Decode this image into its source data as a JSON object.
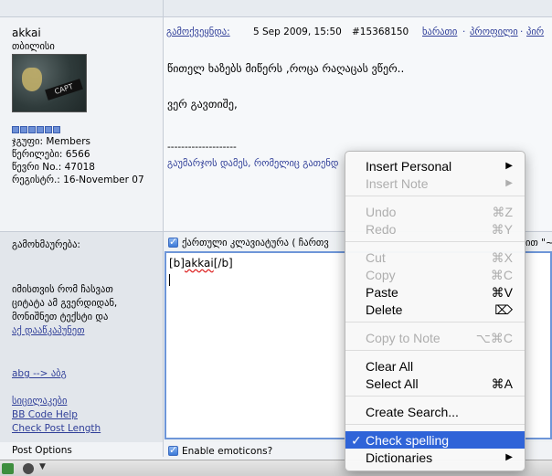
{
  "post": {
    "author": "akkai",
    "city": "თბილისი",
    "avatar_text": "CAPT",
    "group_label": "ჯგუფი: Members",
    "posts_label": "წერილები: 6566",
    "user_no_label": "წევრი No.: 47018",
    "reg_label": "რეგისტრ.: 16-November 07",
    "published_link": "გამოქვეყნდა:",
    "date": "5 Sep 2009, 15:50",
    "post_number": "#15368150",
    "actions": [
      "ხარათი",
      "პროფილი",
      "პირ"
    ],
    "action_sep": "·",
    "body_line1": "წითელ ხაზებს მიწერს ,როცა რაღაცას ვწერ..",
    "body_line2": "ვერ გავთიშე,",
    "signature_divider": "--------------------",
    "signature": "გაუმარჯოს დამეს, რომელიც გათენდ"
  },
  "reply": {
    "label": "გამოხმაურება:",
    "note_line1": "იმისთვის რომ ჩასვათ",
    "note_line2": "ციტატა ამ გვერდიდან,",
    "note_line3": "მონიშნეთ ტექსტი და",
    "note_link": "აქ დააწკაპუნეთ",
    "abg_link": "abg --> აბგ",
    "smilies_link": "სიცილაკები",
    "bbcode_link": "BB Code Help",
    "check_link": "Check Post Length",
    "keyboard_label": "ქართული კლავიატურა ( ჩართვ",
    "keyboard_label_right": "ით \"~",
    "editor_text_prefix": "[b]",
    "editor_text_word": "akkai",
    "editor_text_suffix": "[/b]",
    "post_options_label": "Post Options",
    "emoticons_label": "Enable emoticons?"
  },
  "context_menu": {
    "items": {
      "insert_personal": "Insert Personal",
      "insert_note": "Insert Note",
      "undo": "Undo",
      "undo_sc": "⌘Z",
      "redo": "Redo",
      "redo_sc": "⌘Y",
      "cut": "Cut",
      "cut_sc": "⌘X",
      "copy": "Copy",
      "copy_sc": "⌘C",
      "paste": "Paste",
      "paste_sc": "⌘V",
      "delete": "Delete",
      "delete_sc": "⌦",
      "copy_to_note": "Copy to Note",
      "copy_to_note_sc": "⌥⌘C",
      "clear_all": "Clear All",
      "select_all": "Select All",
      "select_all_sc": "⌘A",
      "create_search": "Create Search...",
      "check_spelling": "Check spelling",
      "check_mark": "✓",
      "dictionaries": "Dictionaries",
      "submenu_arrow": "▶"
    }
  },
  "colors": {
    "link": "#2f3e98",
    "menu_highlight": "#2f64d8",
    "editor_border": "#6e96d8"
  }
}
